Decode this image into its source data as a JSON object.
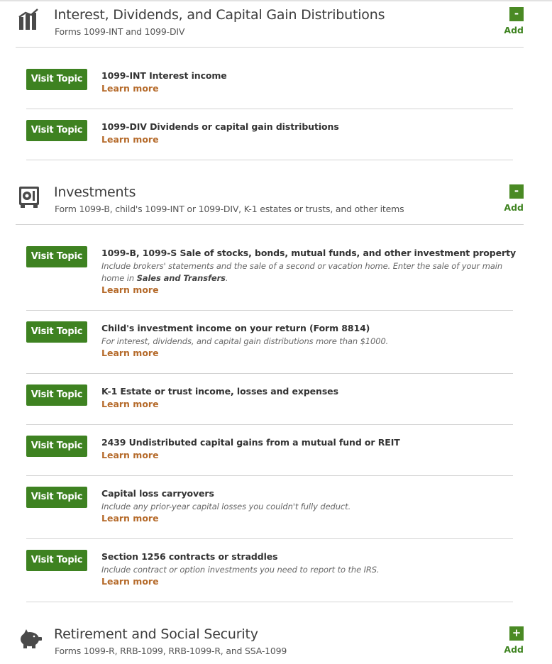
{
  "sections": [
    {
      "title": "Interest, Dividends, and Capital Gain Distributions",
      "subtitle": "Forms 1099-INT and 1099-DIV",
      "toggle": "-",
      "add_label": "Add",
      "icon": "bar-chart-icon"
    },
    {
      "title": "Investments",
      "subtitle": "Form 1099-B, child's 1099-INT or 1099-DIV, K-1 estates or trusts, and other items",
      "toggle": "-",
      "add_label": "Add",
      "icon": "safe-icon"
    },
    {
      "title": "Retirement and Social Security",
      "subtitle": "Forms 1099-R, RRB-1099, RRB-1099-R, and SSA-1099",
      "toggle": "+",
      "add_label": "Add",
      "icon": "piggy-bank-icon"
    }
  ],
  "button_label": "Visit Topic",
  "learn_more": "Learn more",
  "topics": [
    {
      "title": "1099-INT Interest income"
    },
    {
      "title": "1099-DIV Dividends or capital gain distributions"
    },
    {
      "title": "1099-B, 1099-S Sale of stocks, bonds, mutual funds, and other investment property",
      "desc_line1": "Include brokers' statements and the sale of a second or vacation home. Enter the sale of your main",
      "desc_line2_pre": "home in ",
      "desc_line2_bold": "Sales and Transfers",
      "desc_line2_post": "."
    },
    {
      "title": "Child's investment income on your return (Form 8814)",
      "desc": "For interest, dividends, and capital gain distributions more than $1000."
    },
    {
      "title": "K-1 Estate or trust income, losses and expenses"
    },
    {
      "title": "2439 Undistributed capital gains from a mutual fund or REIT"
    },
    {
      "title": "Capital loss carryovers",
      "desc": "Include any prior-year capital losses you couldn't fully deduct."
    },
    {
      "title": "Section 1256 contracts or straddles",
      "desc": "Include contract or option investments you need to report to the IRS."
    }
  ],
  "colors": {
    "button_green": "#3e8221",
    "learn_more": "#b56a2a",
    "toggle_green": "#4a8a24"
  }
}
